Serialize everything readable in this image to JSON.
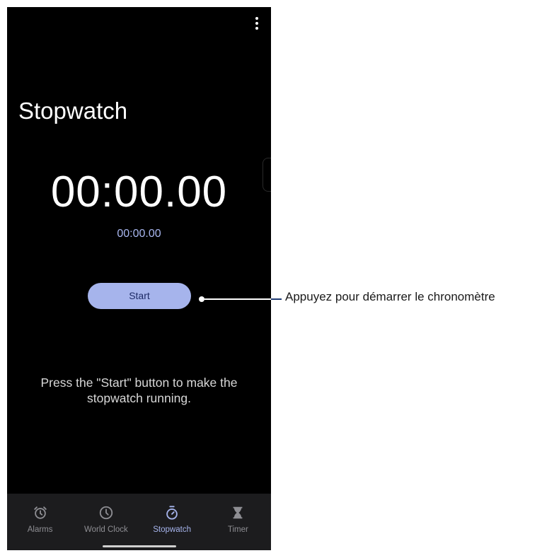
{
  "app": {
    "title": "Stopwatch",
    "more_icon": "more-vertical-icon"
  },
  "stopwatch": {
    "main_time": "00:00.00",
    "lap_time": "00:00.00",
    "start_label": "Start",
    "hint": "Press the \"Start\" button to make the stopwatch running."
  },
  "nav": {
    "items": [
      {
        "label": "Alarms",
        "icon": "alarm-clock-icon",
        "active": false
      },
      {
        "label": "World Clock",
        "icon": "clock-icon",
        "active": false
      },
      {
        "label": "Stopwatch",
        "icon": "stopwatch-icon",
        "active": true
      },
      {
        "label": "Timer",
        "icon": "hourglass-icon",
        "active": false
      }
    ]
  },
  "annotation": {
    "callout": "Appuyez pour démarrer le chronomètre"
  },
  "colors": {
    "background": "#000000",
    "accent": "#a6b4ec",
    "nav_background": "#1c1c1e"
  }
}
